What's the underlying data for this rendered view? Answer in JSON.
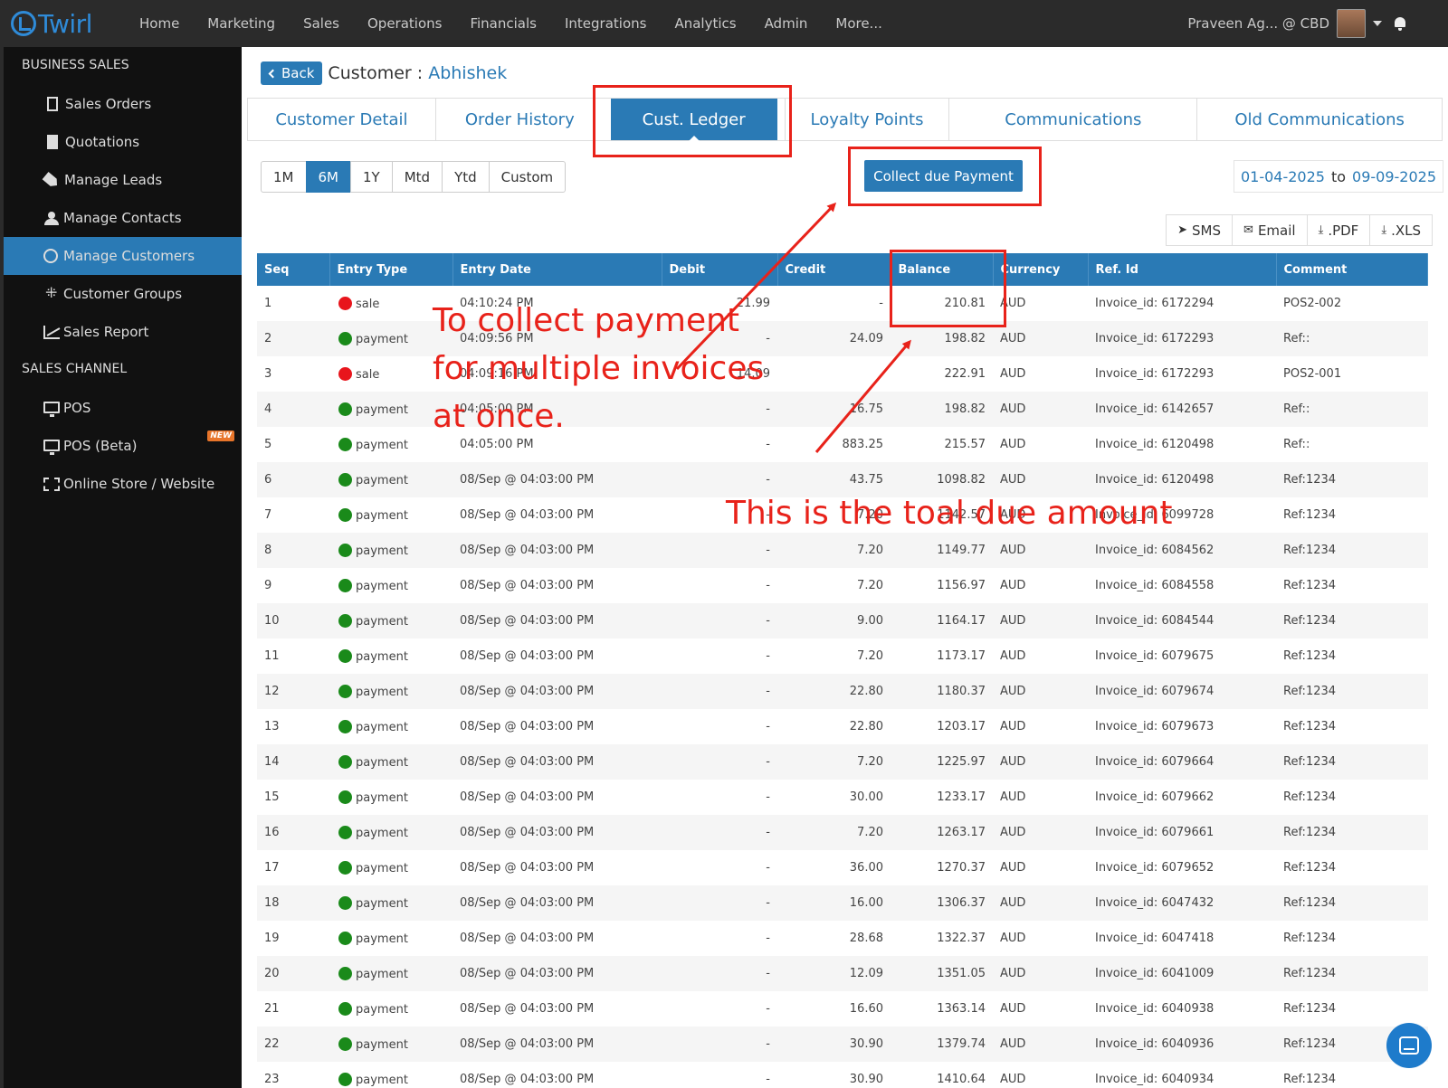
{
  "app": {
    "logo_text": "Twirl"
  },
  "nav": {
    "items": [
      "Home",
      "Marketing",
      "Sales",
      "Operations",
      "Financials",
      "Integrations",
      "Analytics",
      "Admin",
      "More..."
    ],
    "user": "Praveen Ag... @ CBD"
  },
  "sidebar": {
    "sections": [
      {
        "title": "BUSINESS SALES",
        "items": [
          {
            "label": "Sales Orders",
            "icon": "document-icon"
          },
          {
            "label": "Quotations",
            "icon": "document-filled-icon"
          },
          {
            "label": "Manage Leads",
            "icon": "tag-icon"
          },
          {
            "label": "Manage Contacts",
            "icon": "users-icon"
          },
          {
            "label": "Manage Customers",
            "icon": "user-circle-icon",
            "active": true
          },
          {
            "label": "Customer Groups",
            "icon": "groups-icon"
          },
          {
            "label": "Sales Report",
            "icon": "chart-icon"
          }
        ]
      },
      {
        "title": "SALES CHANNEL",
        "items": [
          {
            "label": "POS",
            "icon": "monitor-icon"
          },
          {
            "label": "POS (Beta)",
            "icon": "monitor-icon",
            "badge": "NEW"
          },
          {
            "label": "Online Store / Website",
            "icon": "store-icon"
          }
        ]
      }
    ]
  },
  "header": {
    "back_label": "Back",
    "title_prefix": "Customer : ",
    "customer_name": "Abhishek"
  },
  "tabs": [
    "Customer Detail",
    "Order History",
    "Cust. Ledger",
    "Loyalty Points",
    "Communications",
    "Old Communications"
  ],
  "active_tab": "Cust. Ledger",
  "ranges": [
    "1M",
    "6M",
    "1Y",
    "Mtd",
    "Ytd",
    "Custom"
  ],
  "active_range": "6M",
  "collect_button": "Collect due Payment",
  "date_from": "01-04-2025",
  "date_to_label": "to",
  "date_to": "09-09-2025",
  "exports": [
    {
      "label": "SMS",
      "icon": "paper-plane-icon"
    },
    {
      "label": "Email",
      "icon": "envelope-icon"
    },
    {
      "label": ".PDF",
      "icon": "download-icon"
    },
    {
      "label": ".XLS",
      "icon": "download-icon"
    }
  ],
  "table": {
    "columns": [
      "Seq",
      "Entry Type",
      "Entry Date",
      "Debit",
      "Credit",
      "Balance",
      "Currency",
      "Ref. Id",
      "Comment"
    ],
    "rows": [
      [
        "1",
        "sale",
        "04:10:24 PM",
        "21.99",
        "-",
        "210.81",
        "AUD",
        "Invoice_id: 6172294",
        "POS2-002"
      ],
      [
        "2",
        "payment",
        "04:09:56 PM",
        "-",
        "24.09",
        "198.82",
        "AUD",
        "Invoice_id: 6172293",
        "Ref::"
      ],
      [
        "3",
        "sale",
        "04:09:16 PM",
        "14.09",
        "",
        "222.91",
        "AUD",
        "Invoice_id: 6172293",
        "POS2-001"
      ],
      [
        "4",
        "payment",
        "04:05:00 PM",
        "-",
        "16.75",
        "198.82",
        "AUD",
        "Invoice_id: 6142657",
        "Ref::"
      ],
      [
        "5",
        "payment",
        "04:05:00 PM",
        "-",
        "883.25",
        "215.57",
        "AUD",
        "Invoice_id: 6120498",
        "Ref::"
      ],
      [
        "6",
        "payment",
        "08/Sep @ 04:03:00 PM",
        "-",
        "43.75",
        "1098.82",
        "AUD",
        "Invoice_id: 6120498",
        "Ref:1234"
      ],
      [
        "7",
        "payment",
        "08/Sep @ 04:03:00 PM",
        "-",
        "7.20",
        "1142.57",
        "AUD",
        "Invoice_id: 6099728",
        "Ref:1234"
      ],
      [
        "8",
        "payment",
        "08/Sep @ 04:03:00 PM",
        "-",
        "7.20",
        "1149.77",
        "AUD",
        "Invoice_id: 6084562",
        "Ref:1234"
      ],
      [
        "9",
        "payment",
        "08/Sep @ 04:03:00 PM",
        "-",
        "7.20",
        "1156.97",
        "AUD",
        "Invoice_id: 6084558",
        "Ref:1234"
      ],
      [
        "10",
        "payment",
        "08/Sep @ 04:03:00 PM",
        "-",
        "9.00",
        "1164.17",
        "AUD",
        "Invoice_id: 6084544",
        "Ref:1234"
      ],
      [
        "11",
        "payment",
        "08/Sep @ 04:03:00 PM",
        "-",
        "7.20",
        "1173.17",
        "AUD",
        "Invoice_id: 6079675",
        "Ref:1234"
      ],
      [
        "12",
        "payment",
        "08/Sep @ 04:03:00 PM",
        "-",
        "22.80",
        "1180.37",
        "AUD",
        "Invoice_id: 6079674",
        "Ref:1234"
      ],
      [
        "13",
        "payment",
        "08/Sep @ 04:03:00 PM",
        "-",
        "22.80",
        "1203.17",
        "AUD",
        "Invoice_id: 6079673",
        "Ref:1234"
      ],
      [
        "14",
        "payment",
        "08/Sep @ 04:03:00 PM",
        "-",
        "7.20",
        "1225.97",
        "AUD",
        "Invoice_id: 6079664",
        "Ref:1234"
      ],
      [
        "15",
        "payment",
        "08/Sep @ 04:03:00 PM",
        "-",
        "30.00",
        "1233.17",
        "AUD",
        "Invoice_id: 6079662",
        "Ref:1234"
      ],
      [
        "16",
        "payment",
        "08/Sep @ 04:03:00 PM",
        "-",
        "7.20",
        "1263.17",
        "AUD",
        "Invoice_id: 6079661",
        "Ref:1234"
      ],
      [
        "17",
        "payment",
        "08/Sep @ 04:03:00 PM",
        "-",
        "36.00",
        "1270.37",
        "AUD",
        "Invoice_id: 6079652",
        "Ref:1234"
      ],
      [
        "18",
        "payment",
        "08/Sep @ 04:03:00 PM",
        "-",
        "16.00",
        "1306.37",
        "AUD",
        "Invoice_id: 6047432",
        "Ref:1234"
      ],
      [
        "19",
        "payment",
        "08/Sep @ 04:03:00 PM",
        "-",
        "28.68",
        "1322.37",
        "AUD",
        "Invoice_id: 6047418",
        "Ref:1234"
      ],
      [
        "20",
        "payment",
        "08/Sep @ 04:03:00 PM",
        "-",
        "12.09",
        "1351.05",
        "AUD",
        "Invoice_id: 6041009",
        "Ref:1234"
      ],
      [
        "21",
        "payment",
        "08/Sep @ 04:03:00 PM",
        "-",
        "16.60",
        "1363.14",
        "AUD",
        "Invoice_id: 6040938",
        "Ref:1234"
      ],
      [
        "22",
        "payment",
        "08/Sep @ 04:03:00 PM",
        "-",
        "30.90",
        "1379.74",
        "AUD",
        "Invoice_id: 6040936",
        "Ref:1234"
      ],
      [
        "23",
        "payment",
        "08/Sep @ 04:03:00 PM",
        "-",
        "30.90",
        "1410.64",
        "AUD",
        "Invoice_id: 6040934",
        "Ref:1234"
      ]
    ]
  },
  "annotations": {
    "collect_note": [
      "To collect payment",
      "for multiple invoices",
      "at once."
    ],
    "total_note": "This is the toal due amount",
    "color": "#e8221a"
  },
  "colors": {
    "accent": "#2a7ab5",
    "topbar": "#2b2b2b",
    "sidebar": "#111111",
    "sale_dot": "#e8151c",
    "payment_dot": "#1a8a1a"
  }
}
